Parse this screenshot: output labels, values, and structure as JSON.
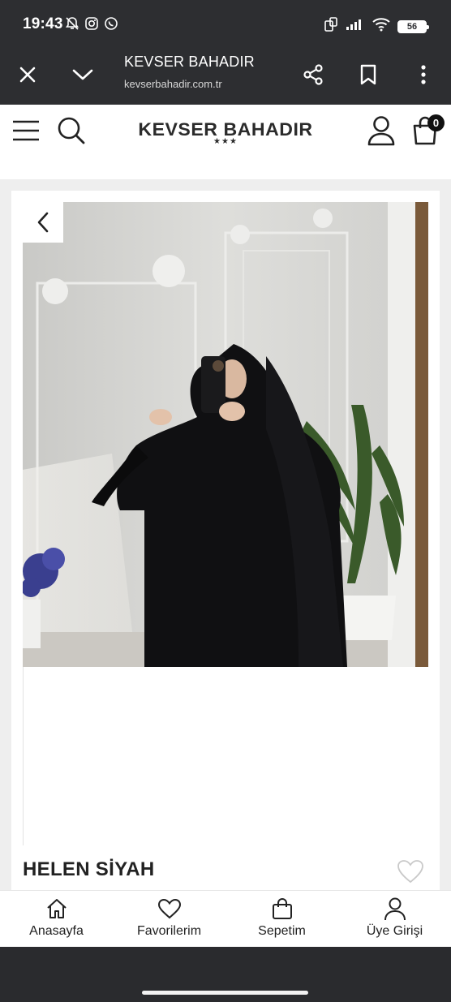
{
  "status_bar": {
    "time": "19:43",
    "battery": "56",
    "icons": [
      "mute-bell-icon",
      "instagram-icon",
      "whatsapp-icon",
      "rotate-icon",
      "signal-icon",
      "wifi-icon",
      "battery-icon"
    ]
  },
  "browser": {
    "title": "KEVSER BAHADIR",
    "url": "kevserbahadir.com.tr",
    "icons": [
      "close-icon",
      "chevron-down-icon",
      "share-icon",
      "bookmark-icon",
      "more-icon"
    ]
  },
  "site_header": {
    "logo_text": "KEVSER BAHADIR",
    "logo_stars": "★★★",
    "cart_count": "0",
    "icons": [
      "menu-icon",
      "search-icon",
      "user-icon",
      "cart-icon"
    ]
  },
  "product": {
    "name": "HELEN SİYAH"
  },
  "bottom_nav": {
    "items": [
      {
        "label": "Anasayfa",
        "icon": "home-icon"
      },
      {
        "label": "Favorilerim",
        "icon": "heart-icon"
      },
      {
        "label": "Sepetim",
        "icon": "bag-icon"
      },
      {
        "label": "Üye Girişi",
        "icon": "user-icon"
      }
    ]
  },
  "colors": {
    "system_bar": "#2d2e31",
    "page_bg": "#eeeeee",
    "text": "#222222"
  }
}
